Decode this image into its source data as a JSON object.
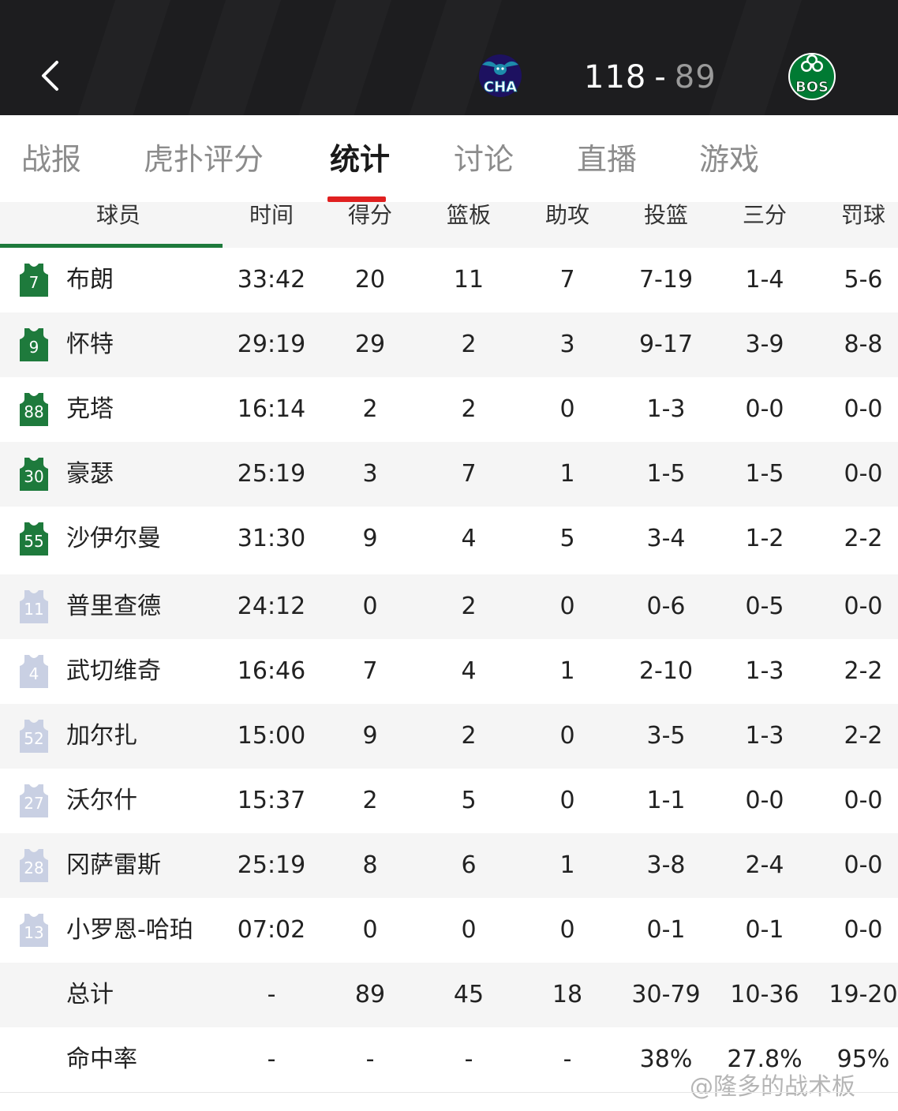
{
  "header": {
    "home_abbr": "CHA",
    "away_abbr": "BOS",
    "home_score": "118",
    "separator": "-",
    "away_score": "89",
    "back_icon": "chevron-left-icon",
    "colors": {
      "background": "#1d1d1f",
      "home_score": "#ffffff",
      "away_score": "#9a9a9a",
      "cha_teal": "#1d8cab",
      "cha_navy": "#1d1160",
      "bos_green": "#007a33"
    }
  },
  "tabs": [
    {
      "label": "战报"
    },
    {
      "label": "虎扑评分"
    },
    {
      "label": "统计",
      "active": true
    },
    {
      "label": "讨论"
    },
    {
      "label": "直播"
    },
    {
      "label": "游戏"
    }
  ],
  "accent": {
    "active_tab_underline": "#e02020",
    "team_line": "#1e7a3c",
    "starter_jersey": "#1e7a3c",
    "bench_jersey": "#c9d0e3"
  },
  "table": {
    "columns": [
      "球员",
      "时间",
      "得分",
      "篮板",
      "助攻",
      "投篮",
      "三分",
      "罚球"
    ],
    "players": [
      {
        "number": "7",
        "name": "布朗",
        "starter": true,
        "min": "33:42",
        "pts": "20",
        "reb": "11",
        "ast": "7",
        "fg": "7-19",
        "tp": "1-4",
        "ft": "5-6"
      },
      {
        "number": "9",
        "name": "怀特",
        "starter": true,
        "min": "29:19",
        "pts": "29",
        "reb": "2",
        "ast": "3",
        "fg": "9-17",
        "tp": "3-9",
        "ft": "8-8"
      },
      {
        "number": "88",
        "name": "克塔",
        "starter": true,
        "min": "16:14",
        "pts": "2",
        "reb": "2",
        "ast": "0",
        "fg": "1-3",
        "tp": "0-0",
        "ft": "0-0"
      },
      {
        "number": "30",
        "name": "豪瑟",
        "starter": true,
        "min": "25:19",
        "pts": "3",
        "reb": "7",
        "ast": "1",
        "fg": "1-5",
        "tp": "1-5",
        "ft": "0-0"
      },
      {
        "number": "55",
        "name": "沙伊尔曼",
        "starter": true,
        "min": "31:30",
        "pts": "9",
        "reb": "4",
        "ast": "5",
        "fg": "3-4",
        "tp": "1-2",
        "ft": "2-2"
      },
      {
        "number": "11",
        "name": "普里查德",
        "starter": false,
        "min": "24:12",
        "pts": "0",
        "reb": "2",
        "ast": "0",
        "fg": "0-6",
        "tp": "0-5",
        "ft": "0-0"
      },
      {
        "number": "4",
        "name": "武切维奇",
        "starter": false,
        "min": "16:46",
        "pts": "7",
        "reb": "4",
        "ast": "1",
        "fg": "2-10",
        "tp": "1-3",
        "ft": "2-2"
      },
      {
        "number": "52",
        "name": "加尔扎",
        "starter": false,
        "min": "15:00",
        "pts": "9",
        "reb": "2",
        "ast": "0",
        "fg": "3-5",
        "tp": "1-3",
        "ft": "2-2"
      },
      {
        "number": "27",
        "name": "沃尔什",
        "starter": false,
        "min": "15:37",
        "pts": "2",
        "reb": "5",
        "ast": "0",
        "fg": "1-1",
        "tp": "0-0",
        "ft": "0-0"
      },
      {
        "number": "28",
        "name": "冈萨雷斯",
        "starter": false,
        "min": "25:19",
        "pts": "8",
        "reb": "6",
        "ast": "1",
        "fg": "3-8",
        "tp": "2-4",
        "ft": "0-0"
      },
      {
        "number": "13",
        "name": "小罗恩-哈珀",
        "starter": false,
        "min": "07:02",
        "pts": "0",
        "reb": "0",
        "ast": "0",
        "fg": "0-1",
        "tp": "0-1",
        "ft": "0-0"
      }
    ],
    "totals": {
      "label": "总计",
      "min": "-",
      "pts": "89",
      "reb": "45",
      "ast": "18",
      "fg": "30-79",
      "tp": "10-36",
      "ft": "19-20"
    },
    "percent": {
      "label": "命中率",
      "min": "-",
      "pts": "-",
      "reb": "-",
      "ast": "-",
      "fg": "38%",
      "tp": "27.8%",
      "ft": "95%"
    }
  },
  "watermark": "@隆多的战术板"
}
